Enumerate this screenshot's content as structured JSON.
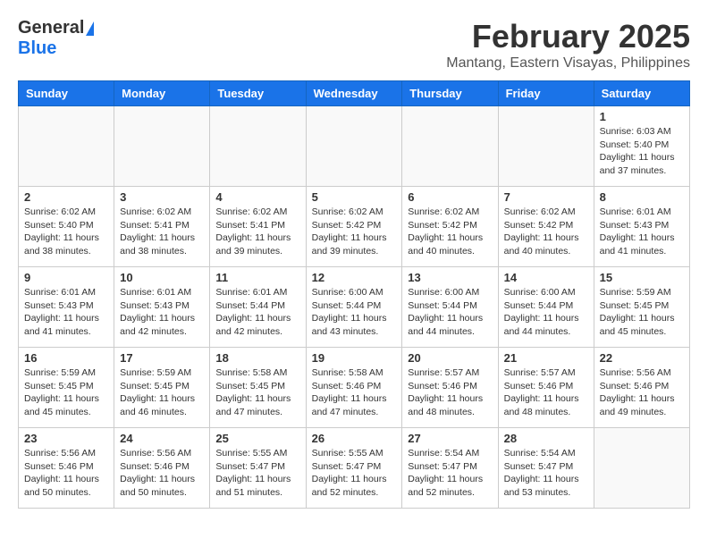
{
  "logo": {
    "general": "General",
    "blue": "Blue"
  },
  "header": {
    "month": "February 2025",
    "location": "Mantang, Eastern Visayas, Philippines"
  },
  "days_of_week": [
    "Sunday",
    "Monday",
    "Tuesday",
    "Wednesday",
    "Thursday",
    "Friday",
    "Saturday"
  ],
  "weeks": [
    [
      {
        "day": "",
        "info": ""
      },
      {
        "day": "",
        "info": ""
      },
      {
        "day": "",
        "info": ""
      },
      {
        "day": "",
        "info": ""
      },
      {
        "day": "",
        "info": ""
      },
      {
        "day": "",
        "info": ""
      },
      {
        "day": "1",
        "info": "Sunrise: 6:03 AM\nSunset: 5:40 PM\nDaylight: 11 hours and 37 minutes."
      }
    ],
    [
      {
        "day": "2",
        "info": "Sunrise: 6:02 AM\nSunset: 5:40 PM\nDaylight: 11 hours and 38 minutes."
      },
      {
        "day": "3",
        "info": "Sunrise: 6:02 AM\nSunset: 5:41 PM\nDaylight: 11 hours and 38 minutes."
      },
      {
        "day": "4",
        "info": "Sunrise: 6:02 AM\nSunset: 5:41 PM\nDaylight: 11 hours and 39 minutes."
      },
      {
        "day": "5",
        "info": "Sunrise: 6:02 AM\nSunset: 5:42 PM\nDaylight: 11 hours and 39 minutes."
      },
      {
        "day": "6",
        "info": "Sunrise: 6:02 AM\nSunset: 5:42 PM\nDaylight: 11 hours and 40 minutes."
      },
      {
        "day": "7",
        "info": "Sunrise: 6:02 AM\nSunset: 5:42 PM\nDaylight: 11 hours and 40 minutes."
      },
      {
        "day": "8",
        "info": "Sunrise: 6:01 AM\nSunset: 5:43 PM\nDaylight: 11 hours and 41 minutes."
      }
    ],
    [
      {
        "day": "9",
        "info": "Sunrise: 6:01 AM\nSunset: 5:43 PM\nDaylight: 11 hours and 41 minutes."
      },
      {
        "day": "10",
        "info": "Sunrise: 6:01 AM\nSunset: 5:43 PM\nDaylight: 11 hours and 42 minutes."
      },
      {
        "day": "11",
        "info": "Sunrise: 6:01 AM\nSunset: 5:44 PM\nDaylight: 11 hours and 42 minutes."
      },
      {
        "day": "12",
        "info": "Sunrise: 6:00 AM\nSunset: 5:44 PM\nDaylight: 11 hours and 43 minutes."
      },
      {
        "day": "13",
        "info": "Sunrise: 6:00 AM\nSunset: 5:44 PM\nDaylight: 11 hours and 44 minutes."
      },
      {
        "day": "14",
        "info": "Sunrise: 6:00 AM\nSunset: 5:44 PM\nDaylight: 11 hours and 44 minutes."
      },
      {
        "day": "15",
        "info": "Sunrise: 5:59 AM\nSunset: 5:45 PM\nDaylight: 11 hours and 45 minutes."
      }
    ],
    [
      {
        "day": "16",
        "info": "Sunrise: 5:59 AM\nSunset: 5:45 PM\nDaylight: 11 hours and 45 minutes."
      },
      {
        "day": "17",
        "info": "Sunrise: 5:59 AM\nSunset: 5:45 PM\nDaylight: 11 hours and 46 minutes."
      },
      {
        "day": "18",
        "info": "Sunrise: 5:58 AM\nSunset: 5:45 PM\nDaylight: 11 hours and 47 minutes."
      },
      {
        "day": "19",
        "info": "Sunrise: 5:58 AM\nSunset: 5:46 PM\nDaylight: 11 hours and 47 minutes."
      },
      {
        "day": "20",
        "info": "Sunrise: 5:57 AM\nSunset: 5:46 PM\nDaylight: 11 hours and 48 minutes."
      },
      {
        "day": "21",
        "info": "Sunrise: 5:57 AM\nSunset: 5:46 PM\nDaylight: 11 hours and 48 minutes."
      },
      {
        "day": "22",
        "info": "Sunrise: 5:56 AM\nSunset: 5:46 PM\nDaylight: 11 hours and 49 minutes."
      }
    ],
    [
      {
        "day": "23",
        "info": "Sunrise: 5:56 AM\nSunset: 5:46 PM\nDaylight: 11 hours and 50 minutes."
      },
      {
        "day": "24",
        "info": "Sunrise: 5:56 AM\nSunset: 5:46 PM\nDaylight: 11 hours and 50 minutes."
      },
      {
        "day": "25",
        "info": "Sunrise: 5:55 AM\nSunset: 5:47 PM\nDaylight: 11 hours and 51 minutes."
      },
      {
        "day": "26",
        "info": "Sunrise: 5:55 AM\nSunset: 5:47 PM\nDaylight: 11 hours and 52 minutes."
      },
      {
        "day": "27",
        "info": "Sunrise: 5:54 AM\nSunset: 5:47 PM\nDaylight: 11 hours and 52 minutes."
      },
      {
        "day": "28",
        "info": "Sunrise: 5:54 AM\nSunset: 5:47 PM\nDaylight: 11 hours and 53 minutes."
      },
      {
        "day": "",
        "info": ""
      }
    ]
  ]
}
